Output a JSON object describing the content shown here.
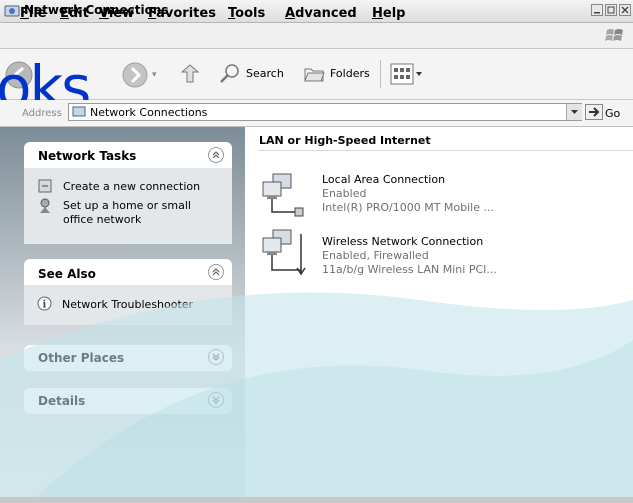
{
  "window": {
    "title": "Network Connections"
  },
  "menu": {
    "items": [
      "File",
      "Edit",
      "View",
      "Favorites",
      "Tools",
      "Advanced",
      "Help"
    ]
  },
  "watermark": {
    "text": "oks"
  },
  "toolbar": {
    "search_label": "Search",
    "folders_label": "Folders"
  },
  "address": {
    "label": "Address",
    "value": "Network Connections",
    "go_label": "Go"
  },
  "left_pane": {
    "network_tasks": {
      "title": "Network Tasks",
      "items": [
        "Create a new connection",
        "Set up a home or small",
        "office network"
      ]
    },
    "see_also": {
      "title": "See Also",
      "items": [
        "Network Troubleshooter"
      ]
    },
    "other_places": {
      "title": "Other Places"
    },
    "details": {
      "title": "Details"
    }
  },
  "content": {
    "section_title": "LAN or High-Speed Internet",
    "connections": [
      {
        "name": "Local Area Connection",
        "status": "Enabled",
        "device": "Intel(R) PRO/1000 MT Mobile ..."
      },
      {
        "name": "Wireless Network Connection",
        "status": "Enabled, Firewalled",
        "device": "11a/b/g Wireless LAN Mini PCI..."
      }
    ]
  },
  "icons": [
    "network-folder-icon",
    "minimize-icon",
    "maximize-icon",
    "close-icon",
    "windows-logo-icon",
    "back-arrow-icon",
    "forward-arrow-icon",
    "up-folder-icon",
    "search-icon",
    "folders-icon",
    "views-icon",
    "address-network-icon",
    "dropdown-arrow-icon",
    "go-arrow-icon",
    "collapse-up-icon",
    "expand-down-icon",
    "new-connection-icon",
    "home-network-icon",
    "info-icon",
    "lan-connection-icon",
    "wireless-connection-icon"
  ],
  "colors": {
    "accent": "#0033cc",
    "overlay": "#cfe9ee",
    "panel_text": "#215dc6"
  }
}
